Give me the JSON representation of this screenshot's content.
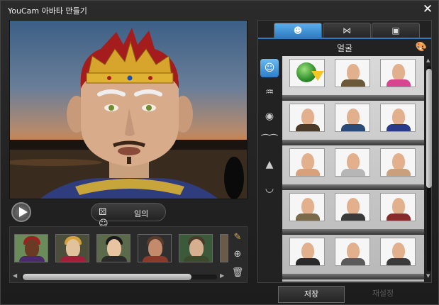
{
  "window": {
    "title": "YouCam 아바타 만들기"
  },
  "controls": {
    "random_label": "임의"
  },
  "tabs": [
    {
      "icon": "face-tab-icon",
      "active": true
    },
    {
      "icon": "accessory-tab-icon",
      "active": false
    },
    {
      "icon": "background-tab-icon",
      "active": false
    }
  ],
  "panel": {
    "category_title": "얼굴"
  },
  "categories": [
    "face",
    "hair",
    "eyes",
    "eyebrows",
    "nose",
    "lips"
  ],
  "footer": {
    "save_label": "저장",
    "reset_label": "재설정"
  },
  "colors": {
    "accent": "#2e7bc4",
    "panel_bg": "#222222",
    "window_bg": "#1c1c1c"
  },
  "icons": {
    "trash": "trash-icon",
    "add": "add-avatar-icon",
    "edit": "edit-avatar-icon",
    "palette": "palette-icon"
  }
}
